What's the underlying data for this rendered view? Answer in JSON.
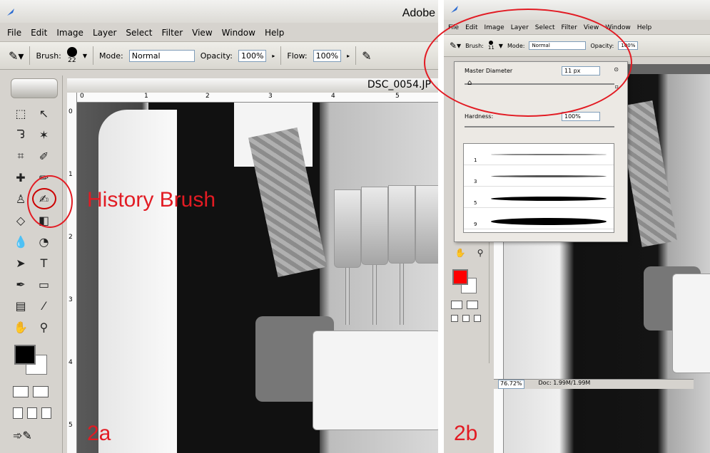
{
  "left_panel": {
    "title": "Adobe",
    "menu": [
      "File",
      "Edit",
      "Image",
      "Layer",
      "Select",
      "Filter",
      "View",
      "Window",
      "Help"
    ],
    "options": {
      "brush_label": "Brush:",
      "brush_size": "22",
      "mode_label": "Mode:",
      "mode_value": "Normal",
      "opacity_label": "Opacity:",
      "opacity_value": "100%",
      "flow_label": "Flow:",
      "flow_value": "100%"
    },
    "doc_title": "DSC_0054.JP",
    "ruler_h": [
      "0",
      "1",
      "2",
      "3",
      "4",
      "5"
    ],
    "ruler_v": [
      "0",
      "1",
      "2",
      "3",
      "4",
      "5"
    ],
    "annotation": "History Brush",
    "panel_label": "2a",
    "icons": [
      "marquee-icon",
      "move-icon",
      "lasso-icon",
      "magic-wand-icon",
      "crop-icon",
      "slice-icon",
      "healing-icon",
      "brush-icon",
      "stamp-icon",
      "history-brush-icon",
      "eraser-icon",
      "gradient-icon",
      "blur-icon",
      "dodge-icon",
      "path-select-icon",
      "type-icon",
      "pen-icon",
      "shape-icon",
      "notes-icon",
      "eyedropper-icon",
      "hand-icon",
      "zoom-icon"
    ]
  },
  "right_panel": {
    "menu": [
      "File",
      "Edit",
      "Image",
      "Layer",
      "Select",
      "Filter",
      "View",
      "Window",
      "Help"
    ],
    "options": {
      "brush_label": "Brush:",
      "brush_size": "11",
      "mode_label": "Mode:",
      "mode_value": "Normal",
      "opacity_label": "Opacity:",
      "opacity_value": "100%"
    },
    "popup": {
      "master_label": "Master Diameter",
      "master_value": "11 px",
      "hardness_label": "Hardness:",
      "hardness_value": "100%",
      "strokes": [
        "1",
        "3",
        "5",
        "9"
      ]
    },
    "status": {
      "zoom": "76.72%",
      "doc": "Doc: 1.99M/1.99M"
    },
    "panel_label": "2b"
  }
}
